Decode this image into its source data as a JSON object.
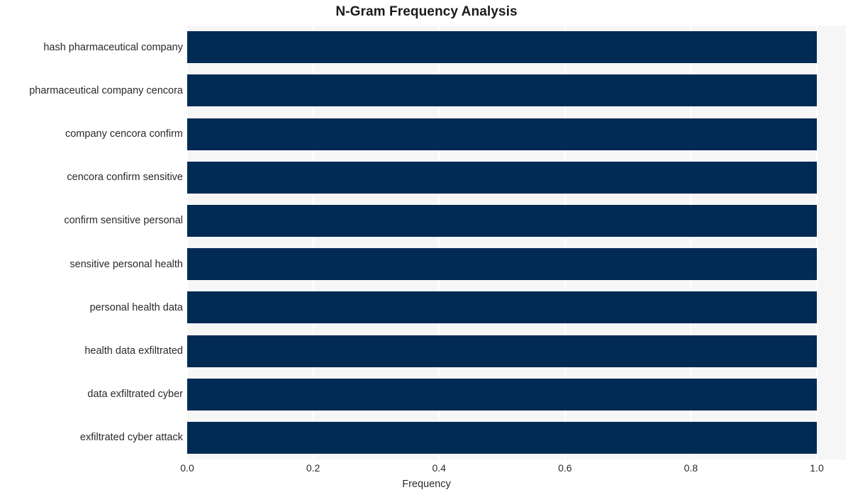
{
  "chart_data": {
    "type": "bar",
    "orientation": "horizontal",
    "title": "N-Gram Frequency Analysis",
    "xlabel": "Frequency",
    "ylabel": "",
    "categories": [
      "hash pharmaceutical company",
      "pharmaceutical company cencora",
      "company cencora confirm",
      "cencora confirm sensitive",
      "confirm sensitive personal",
      "sensitive personal health",
      "personal health data",
      "health data exfiltrated",
      "data exfiltrated cyber",
      "exfiltrated cyber attack"
    ],
    "values": [
      1.0,
      1.0,
      1.0,
      1.0,
      1.0,
      1.0,
      1.0,
      1.0,
      1.0,
      1.0
    ],
    "xlim": [
      0.0,
      1.0
    ],
    "xticks": [
      "0.0",
      "0.2",
      "0.4",
      "0.6",
      "0.8",
      "1.0"
    ],
    "xtick_values": [
      0.0,
      0.2,
      0.4,
      0.6,
      0.8,
      1.0
    ],
    "grid": true,
    "grid_axis": "x",
    "legend": null,
    "bar_color": "#012a54",
    "plot_background": "#f6f6f7",
    "figure_background": "#ffffff",
    "gridline_color": "#ffffff",
    "text_color": "#2a2a2a",
    "title_color": "#1a1a1a"
  }
}
